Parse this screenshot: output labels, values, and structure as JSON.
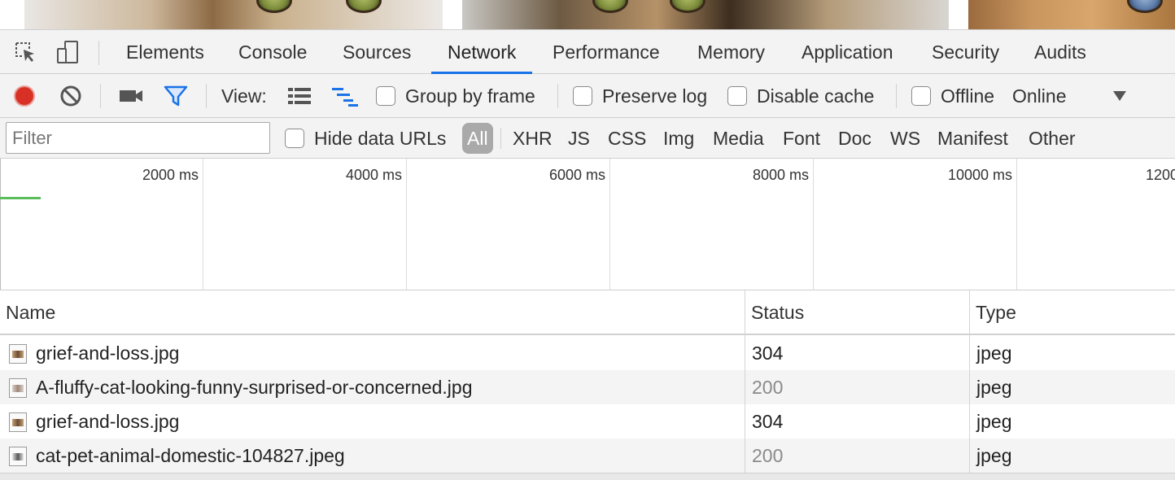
{
  "devtools": {
    "tabs": [
      {
        "label": "Elements"
      },
      {
        "label": "Console"
      },
      {
        "label": "Sources"
      },
      {
        "label": "Network"
      },
      {
        "label": "Performance"
      },
      {
        "label": "Memory"
      },
      {
        "label": "Application"
      },
      {
        "label": "Security"
      },
      {
        "label": "Audits"
      }
    ],
    "active_tab": "Network",
    "icons": {
      "inspect": "inspect-element-icon",
      "device": "device-toolbar-icon",
      "record": "record-icon",
      "clear": "clear-icon",
      "capture": "video-camera-icon",
      "filter": "filter-funnel-icon",
      "large_rows": "large-request-rows-icon",
      "waterfall": "waterfall-overview-icon",
      "throttle_menu": "dropdown-triangle-icon"
    },
    "colors": {
      "record": "#d93025",
      "filter_active": "#1a73e8",
      "active_tab_underline": "#1a73e8",
      "progress_green": "#5bbd5b"
    }
  },
  "toolbar": {
    "view_label": "View:",
    "group_by_frame": {
      "label": "Group by frame",
      "checked": false
    },
    "preserve_log": {
      "label": "Preserve log",
      "checked": false
    },
    "disable_cache": {
      "label": "Disable cache",
      "checked": false
    },
    "offline": {
      "label": "Offline",
      "checked": false
    },
    "throttling": "Online"
  },
  "filter": {
    "placeholder": "Filter",
    "value": "",
    "hide_data_urls": {
      "label": "Hide data URLs",
      "checked": false
    },
    "types": [
      "All",
      "XHR",
      "JS",
      "CSS",
      "Img",
      "Media",
      "Font",
      "Doc",
      "WS",
      "Manifest",
      "Other"
    ],
    "active_type": "All"
  },
  "overview": {
    "ticks": [
      "2000 ms",
      "4000 ms",
      "6000 ms",
      "8000 ms",
      "10000 ms",
      "1200"
    ]
  },
  "table": {
    "columns": [
      "Name",
      "Status",
      "Type"
    ],
    "rows": [
      {
        "name": "grief-and-loss.jpg",
        "status": "304",
        "type": "jpeg",
        "status_dim": false
      },
      {
        "name": "A-fluffy-cat-looking-funny-surprised-or-concerned.jpg",
        "status": "200",
        "type": "jpeg",
        "status_dim": true
      },
      {
        "name": "grief-and-loss.jpg",
        "status": "304",
        "type": "jpeg",
        "status_dim": false
      },
      {
        "name": "cat-pet-animal-domestic-104827.jpeg",
        "status": "200",
        "type": "jpeg",
        "status_dim": true
      }
    ]
  }
}
